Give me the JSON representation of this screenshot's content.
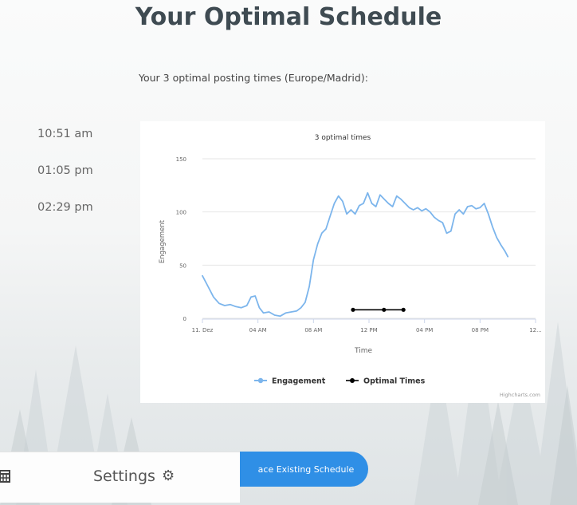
{
  "page": {
    "title": "Your Optimal Schedule",
    "subtitle": "Your 3 optimal posting times (Europe/Madrid):"
  },
  "times": [
    "10:51 am",
    "01:05 pm",
    "02:29 pm"
  ],
  "action_button": {
    "label": "Replace Existing Schedule",
    "visible_label": "ace Existing Schedule"
  },
  "bottom_bar": {
    "settings_label": "Settings",
    "icons": [
      "calendar-grid-icon",
      "gear-icon"
    ]
  },
  "chart_data": {
    "type": "line",
    "title": "3 optimal times",
    "xlabel": "Time",
    "ylabel": "Engagement",
    "ylim": [
      0,
      150
    ],
    "yticks": [
      0,
      50,
      100,
      150
    ],
    "xticks": [
      "11. Dez",
      "04 AM",
      "08 AM",
      "12 PM",
      "04 PM",
      "08 PM",
      "12..."
    ],
    "xlim_hours": [
      0,
      24
    ],
    "credits": "Highcharts.com",
    "grid": true,
    "legend_position": "bottom",
    "series": [
      {
        "name": "Engagement",
        "color": "#7cb5ec",
        "points": [
          [
            0,
            40
          ],
          [
            0.4,
            30
          ],
          [
            0.8,
            20
          ],
          [
            1.2,
            14
          ],
          [
            1.6,
            12
          ],
          [
            2.0,
            13
          ],
          [
            2.4,
            11
          ],
          [
            2.8,
            10
          ],
          [
            3.2,
            12
          ],
          [
            3.5,
            20
          ],
          [
            3.8,
            21
          ],
          [
            4.1,
            10
          ],
          [
            4.4,
            5
          ],
          [
            4.8,
            6
          ],
          [
            5.2,
            3
          ],
          [
            5.6,
            2
          ],
          [
            6.0,
            5
          ],
          [
            6.4,
            6
          ],
          [
            6.8,
            7
          ],
          [
            7.1,
            10
          ],
          [
            7.4,
            15
          ],
          [
            7.7,
            30
          ],
          [
            8.0,
            55
          ],
          [
            8.3,
            70
          ],
          [
            8.6,
            80
          ],
          [
            8.9,
            84
          ],
          [
            9.2,
            96
          ],
          [
            9.5,
            108
          ],
          [
            9.8,
            115
          ],
          [
            10.1,
            110
          ],
          [
            10.4,
            98
          ],
          [
            10.7,
            102
          ],
          [
            11.0,
            98
          ],
          [
            11.3,
            106
          ],
          [
            11.6,
            108
          ],
          [
            11.9,
            118
          ],
          [
            12.2,
            108
          ],
          [
            12.5,
            105
          ],
          [
            12.8,
            116
          ],
          [
            13.1,
            112
          ],
          [
            13.4,
            108
          ],
          [
            13.7,
            105
          ],
          [
            14.0,
            115
          ],
          [
            14.3,
            112
          ],
          [
            14.6,
            108
          ],
          [
            14.9,
            104
          ],
          [
            15.2,
            102
          ],
          [
            15.5,
            104
          ],
          [
            15.8,
            101
          ],
          [
            16.1,
            103
          ],
          [
            16.4,
            100
          ],
          [
            16.7,
            95
          ],
          [
            17.0,
            92
          ],
          [
            17.3,
            90
          ],
          [
            17.6,
            80
          ],
          [
            17.9,
            82
          ],
          [
            18.2,
            98
          ],
          [
            18.5,
            102
          ],
          [
            18.8,
            98
          ],
          [
            19.1,
            105
          ],
          [
            19.4,
            106
          ],
          [
            19.7,
            103
          ],
          [
            20.0,
            104
          ],
          [
            20.3,
            108
          ],
          [
            20.6,
            98
          ],
          [
            20.9,
            86
          ],
          [
            21.2,
            76
          ],
          [
            21.5,
            69
          ],
          [
            21.8,
            63
          ],
          [
            22.0,
            58
          ]
        ]
      },
      {
        "name": "Optimal Times",
        "color": "#000000",
        "points": [
          [
            10.85,
            8
          ],
          [
            13.08,
            8
          ],
          [
            14.48,
            8
          ]
        ]
      }
    ]
  }
}
